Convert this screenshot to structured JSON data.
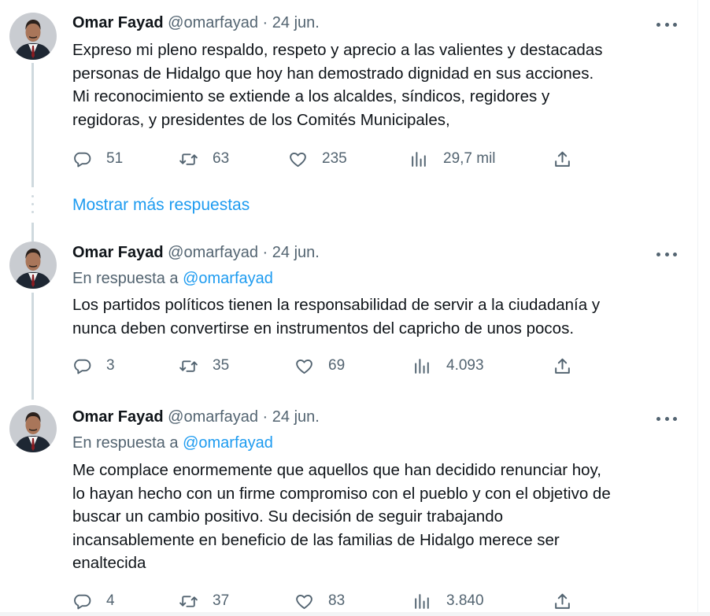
{
  "show_more": "Mostrar más respuestas",
  "tweets": [
    {
      "name": "Omar Fayad",
      "handle": "@omarfayad",
      "separator": "·",
      "date": "24 jun.",
      "reply_prefix": "",
      "reply_mention": "",
      "lines": [
        "Expreso mi pleno respaldo, respeto y aprecio a las valientes y destacadas",
        "personas de Hidalgo que hoy han demostrado dignidad en sus acciones.",
        "Mi reconocimiento se extiende a los alcaldes, síndicos, regidores y",
        "regidoras, y presidentes de los Comités Municipales,"
      ],
      "replies": "51",
      "retweets": "63",
      "likes": "235",
      "views": "29,7 mil"
    },
    {
      "name": "Omar Fayad",
      "handle": "@omarfayad",
      "separator": "·",
      "date": "24 jun.",
      "reply_prefix": "En respuesta a ",
      "reply_mention": "@omarfayad",
      "lines": [
        "Los partidos políticos tienen la responsabilidad de servir a la ciudadanía y",
        "nunca deben convertirse en instrumentos del capricho de unos pocos."
      ],
      "replies": "3",
      "retweets": "35",
      "likes": "69",
      "views": "4.093"
    },
    {
      "name": "Omar Fayad",
      "handle": "@omarfayad",
      "separator": "·",
      "date": "24 jun.",
      "reply_prefix": "En respuesta a ",
      "reply_mention": "@omarfayad",
      "lines": [
        "Me complace enormemente que aquellos que han decidido renunciar hoy,",
        "lo hayan hecho con un firme compromiso con el pueblo y con el objetivo de",
        "buscar un cambio positivo. Su decisión de seguir trabajando",
        "incansablemente en beneficio de las familias de Hidalgo merece ser",
        "enaltecida"
      ],
      "replies": "4",
      "retweets": "37",
      "likes": "83",
      "views": "3.840"
    }
  ],
  "icons": {
    "reply": "reply-icon",
    "retweet": "retweet-icon",
    "like": "heart-icon",
    "views": "views-icon",
    "share": "share-icon",
    "more": "more-icon"
  },
  "colors": {
    "text": "#0f1419",
    "secondary": "#536471",
    "link": "#1d9bf0",
    "thread_line": "#cfd9de"
  }
}
